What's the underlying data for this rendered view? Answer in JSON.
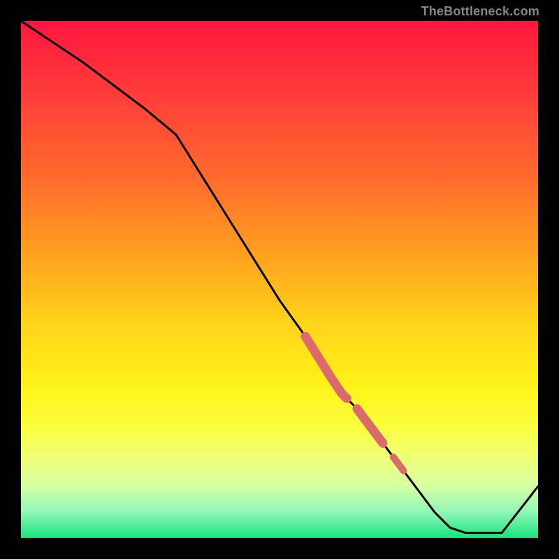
{
  "watermark": "TheBottleneck.com",
  "chart_data": {
    "type": "line",
    "title": "",
    "xlabel": "",
    "ylabel": "",
    "xlim": [
      0,
      100
    ],
    "ylim": [
      0,
      100
    ],
    "series": [
      {
        "name": "curve",
        "x": [
          0,
          12,
          24,
          30,
          35,
          40,
          45,
          50,
          55,
          60,
          62,
          65,
          68,
          71,
          74,
          77,
          80,
          83,
          86,
          88,
          93,
          100
        ],
        "values": [
          100,
          92,
          83,
          78,
          70,
          62,
          54,
          46,
          39,
          31,
          28,
          25,
          21,
          17,
          13,
          9,
          5,
          2,
          1,
          1,
          1,
          10
        ]
      }
    ],
    "highlight_segments": [
      {
        "x": [
          55,
          63
        ],
        "thick": true
      },
      {
        "x": [
          65,
          70
        ],
        "thick": true
      },
      {
        "x": [
          72,
          74
        ],
        "thick": false
      }
    ],
    "highlight_color": "#db6b6a",
    "gradient_stops": [
      {
        "pos": 0.0,
        "color": "#ff153f"
      },
      {
        "pos": 0.15,
        "color": "#ff3f3a"
      },
      {
        "pos": 0.3,
        "color": "#ff6a2c"
      },
      {
        "pos": 0.45,
        "color": "#ffa01f"
      },
      {
        "pos": 0.58,
        "color": "#ffd21a"
      },
      {
        "pos": 0.7,
        "color": "#fff118"
      },
      {
        "pos": 0.78,
        "color": "#faff3a"
      },
      {
        "pos": 0.84,
        "color": "#efff72"
      },
      {
        "pos": 0.9,
        "color": "#d6ffa4"
      },
      {
        "pos": 0.95,
        "color": "#90f7b6"
      },
      {
        "pos": 1.0,
        "color": "#15e47e"
      }
    ]
  }
}
